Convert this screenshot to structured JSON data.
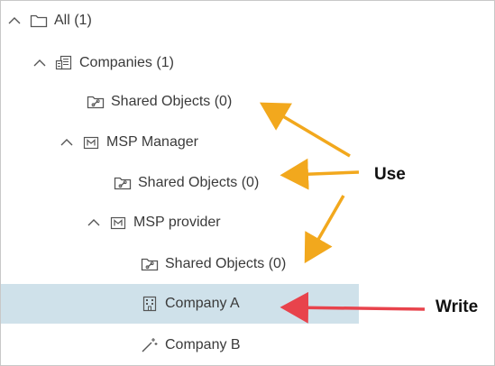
{
  "tree": {
    "nodes": [
      {
        "label": "All (1)",
        "icon": "folder-icon",
        "expanded": true
      },
      {
        "label": "Companies (1)",
        "icon": "companies-icon",
        "expanded": true
      },
      {
        "label": "Shared Objects (0)",
        "icon": "shared-folder-icon"
      },
      {
        "label": "MSP Manager",
        "icon": "msp-icon",
        "expanded": true
      },
      {
        "label": "Shared Objects (0)",
        "icon": "shared-folder-icon"
      },
      {
        "label": "MSP provider",
        "icon": "msp-icon",
        "expanded": true
      },
      {
        "label": "Shared Objects (0)",
        "icon": "shared-folder-icon"
      },
      {
        "label": "Company A",
        "icon": "building-icon",
        "selected": true
      },
      {
        "label": "Company B",
        "icon": "wand-icon"
      }
    ]
  },
  "callouts": {
    "use_label": "Use",
    "write_label": "Write",
    "use_color": "#f2a81d",
    "write_color": "#e8434c"
  },
  "colors": {
    "selected_background": "#cfe1ea",
    "text": "#3a3a3a",
    "icon": "#555555"
  }
}
